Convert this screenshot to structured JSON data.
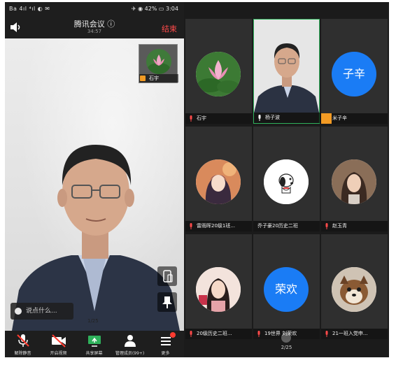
{
  "left_phone": {
    "status_bar": {
      "left_text": "Ba 4ıl ⁴ıl ◐ ✉",
      "right_text": "✈ ◉ 42% ▭ 3:04"
    },
    "header": {
      "title": "腾讯会议 ⓘ",
      "timer": "34:57",
      "end_label": "结束"
    },
    "pip": {
      "name": "石宇"
    },
    "chat_placeholder": "说点什么...",
    "page_indicator": "1/25",
    "toolbar": [
      {
        "label": "解除静音",
        "icon": "mic-muted-icon"
      },
      {
        "label": "开启视频",
        "icon": "camera-off-icon"
      },
      {
        "label": "共享屏幕",
        "icon": "screen-share-icon"
      },
      {
        "label": "管理成员(99+)",
        "icon": "members-icon"
      },
      {
        "label": "更多",
        "icon": "more-menu-icon"
      }
    ]
  },
  "right_phone": {
    "participants": [
      {
        "name": "石宇",
        "avatar": "lotus-flower-image"
      },
      {
        "name": "杨子波",
        "avatar": "live-video",
        "active": true
      },
      {
        "name": "米子辛",
        "avatar_text": "子辛",
        "host": true
      },
      {
        "name": "雷雨晖20级1班...",
        "avatar": "anime-girl-image"
      },
      {
        "name": "乔子豪20历史二班",
        "avatar": "snoopy-image"
      },
      {
        "name": "赵玉青",
        "avatar": "girl-photo-image"
      },
      {
        "name": "20级历史二班...",
        "avatar": "girl-portrait-image"
      },
      {
        "name": "19世界 刘荣欢",
        "avatar_text": "荣欢"
      },
      {
        "name": "21一班入党申...",
        "avatar": "dog-image"
      }
    ],
    "page_indicator": "2/25"
  },
  "colors": {
    "end_red": "#ff4a4a",
    "active_green": "#2fb15b",
    "avatar_blue": "#1a7cf5",
    "host_orange": "#f39b24"
  }
}
